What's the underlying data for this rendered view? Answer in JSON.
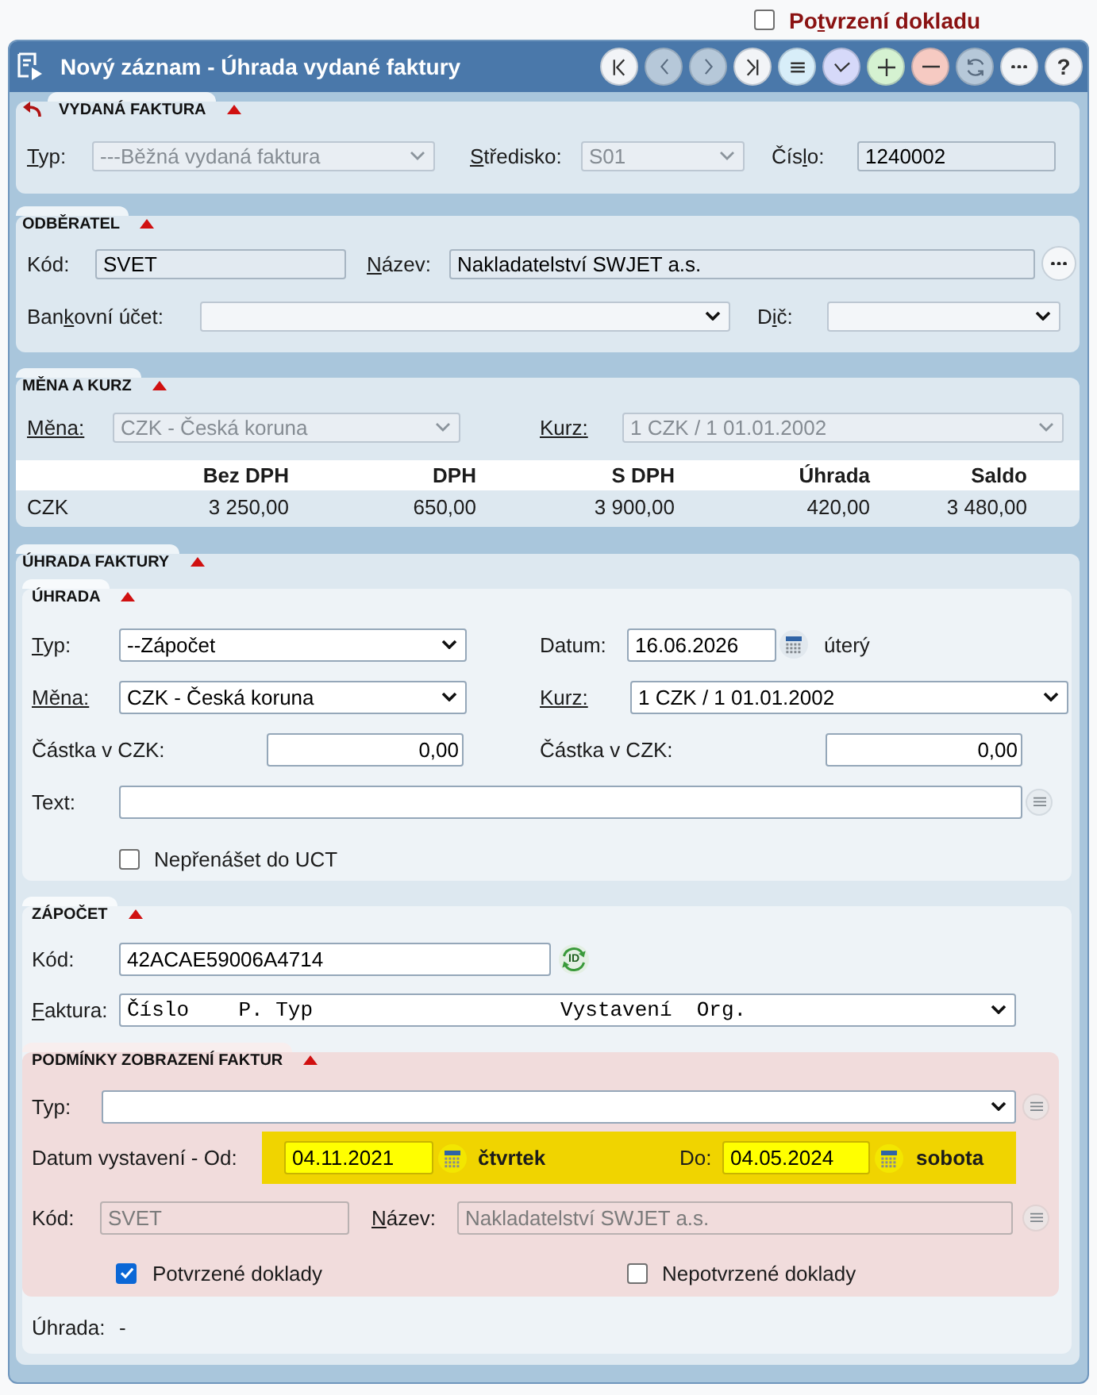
{
  "confirm_toggle": {
    "label": [
      {
        "text": "Po",
        "underline": false
      },
      {
        "text": "t",
        "underline": true
      },
      {
        "text": "vrzení dokladu",
        "underline": false
      }
    ],
    "checked": false
  },
  "window": {
    "title": "Nový záznam - Úhrada vydané faktury",
    "toolbar": [
      {
        "kind": "first",
        "disabled": false
      },
      {
        "kind": "previous",
        "disabled": true
      },
      {
        "kind": "next",
        "disabled": true
      },
      {
        "kind": "last",
        "disabled": false
      },
      {
        "kind": "list",
        "disabled": false
      },
      {
        "kind": "confirm",
        "disabled": false
      },
      {
        "kind": "add",
        "disabled": false
      },
      {
        "kind": "remove",
        "disabled": false
      },
      {
        "kind": "refresh",
        "disabled": true
      },
      {
        "kind": "more",
        "disabled": false
      },
      {
        "kind": "help",
        "disabled": false,
        "glyph": "?"
      }
    ]
  },
  "issued_invoice": {
    "title": "VYDANÁ FAKTURA",
    "expanded": true,
    "type": {
      "label": [
        {
          "text": "T",
          "underline": true
        },
        {
          "text": "yp:",
          "underline": false
        }
      ],
      "value": "---Běžná vydaná faktura",
      "disabled": true
    },
    "center": {
      "label": [
        {
          "text": "S",
          "underline": true
        },
        {
          "text": "tředisko:",
          "underline": false
        }
      ],
      "value": "S01",
      "disabled": true
    },
    "number": {
      "label": [
        {
          "text": "Čís",
          "underline": false
        },
        {
          "text": "l",
          "underline": true
        },
        {
          "text": "o:",
          "underline": false
        }
      ],
      "value": "1240002",
      "disabled": false,
      "readonly": true
    }
  },
  "customer": {
    "title": "ODBĚRATEL",
    "expanded": true,
    "code": {
      "label": "Kód:",
      "value": "SVET",
      "disabled": false,
      "readonly": true
    },
    "name": {
      "label": [
        {
          "text": "N",
          "underline": true
        },
        {
          "text": "ázev:",
          "underline": false
        }
      ],
      "value": "Nakladatelství SWJET a.s.",
      "disabled": false,
      "readonly": true
    },
    "bank_account": {
      "label": [
        {
          "text": "Ban",
          "underline": false
        },
        {
          "text": "k",
          "underline": true
        },
        {
          "text": "ovní účet:",
          "underline": false
        }
      ],
      "disabled": false
    },
    "tax_id": {
      "label": [
        {
          "text": "D",
          "underline": false
        },
        {
          "text": "i",
          "underline": true
        },
        {
          "text": "č:",
          "underline": false
        }
      ],
      "disabled": false
    }
  },
  "currency_rate": {
    "title": "MĚNA A KURZ",
    "expanded": true,
    "currency": {
      "label": [
        {
          "text": "Měna:",
          "underline": true
        }
      ],
      "value": "CZK - Česká koruna",
      "disabled": true
    },
    "rate": {
      "label": [
        {
          "text": "Kurz:",
          "underline": true
        }
      ],
      "value": "1 CZK / 1 01.01.2002",
      "disabled": true
    },
    "table": {
      "columns": [
        "Bez DPH",
        "DPH",
        "S DPH",
        "Úhrada",
        "Saldo"
      ],
      "rows": [
        {
          "currency": "CZK",
          "cells": [
            "3 250,00",
            "650,00",
            "3 900,00",
            "420,00",
            "3 480,00"
          ]
        }
      ]
    }
  },
  "invoice_payment": {
    "title": "ÚHRADA FAKTURY",
    "expanded": true,
    "payment": {
      "title": "ÚHRADA",
      "expanded": true,
      "type": {
        "label": [
          {
            "text": "T",
            "underline": true
          },
          {
            "text": "yp:",
            "underline": false
          }
        ],
        "value": "--Zápočet",
        "disabled": false
      },
      "date": {
        "label": "Datum:",
        "value": "16.06.2026",
        "weekday": "úterý",
        "disabled": false,
        "readonly": false
      },
      "currency": {
        "label": [
          {
            "text": "Měna:",
            "underline": true
          }
        ],
        "value": "CZK - Česká koruna",
        "disabled": false
      },
      "rate": {
        "label": [
          {
            "text": "Kurz:",
            "underline": true
          }
        ],
        "value": "1 CZK / 1 01.01.2002",
        "disabled": false
      },
      "amount": {
        "label": "Částka v CZK:",
        "value": "0,00",
        "disabled": false,
        "readonly": false
      },
      "amount_converted": {
        "label": "Částka v CZK:",
        "value": "0,00",
        "disabled": false,
        "readonly": false
      },
      "text": {
        "label": "Text:",
        "disabled": false,
        "readonly": false
      },
      "no_transfer": {
        "label": "Nepřenášet do UCT",
        "checked": false
      }
    },
    "offset": {
      "title": "ZÁPOČET",
      "expanded": true,
      "code": {
        "label": "Kód:",
        "value": "42ACAE59006A4714",
        "disabled": false,
        "readonly": false
      },
      "id_button": {
        "text": "ID"
      },
      "invoice": {
        "label": [
          {
            "text": "F",
            "underline": true
          },
          {
            "text": "aktura:",
            "underline": false
          }
        ],
        "value": "Číslo    P. Typ                    Vystavení  Org.",
        "disabled": false
      },
      "filter": {
        "title": "PODMÍNKY ZOBRAZENÍ FAKTUR",
        "expanded": true,
        "type": {
          "label": "Typ:",
          "disabled": false
        },
        "issue_date": {
          "label": "Datum vystavení - Od:",
          "highlighted": true,
          "from": {
            "value": "04.11.2021",
            "weekday": "čtvrtek"
          },
          "to_label": "Do:",
          "to": {
            "value": "04.05.2024",
            "weekday": "sobota"
          }
        },
        "code": {
          "label": "Kód:",
          "value": "SVET",
          "disabled": true
        },
        "name": {
          "label": [
            {
              "text": "N",
              "underline": true
            },
            {
              "text": "ázev:",
              "underline": false
            }
          ],
          "value": "Nakladatelství SWJET a.s.",
          "disabled": true
        },
        "confirmed": {
          "label": "Potvrzené doklady",
          "checked": true
        },
        "unconfirmed": {
          "label": "Nepotvrzené doklady",
          "checked": false
        }
      },
      "payment_info": {
        "label": "Úhrada:",
        "value": "-"
      }
    }
  }
}
